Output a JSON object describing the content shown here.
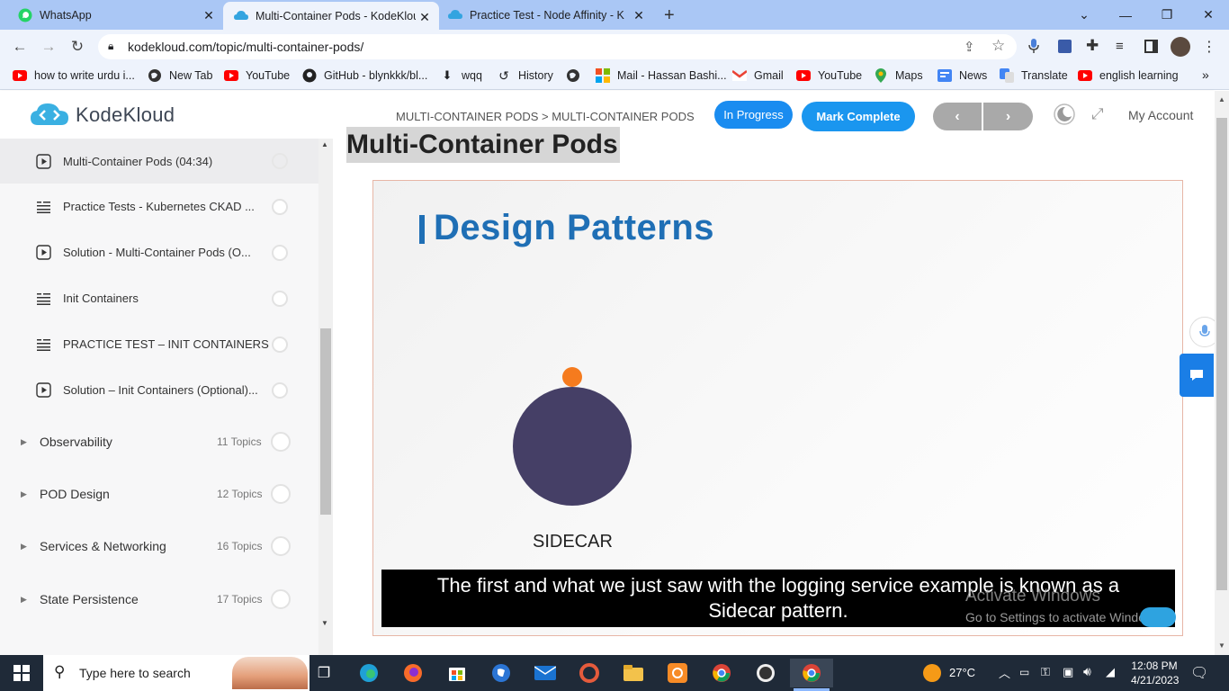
{
  "browser": {
    "tabs": [
      {
        "title": "WhatsApp",
        "active": false
      },
      {
        "title": "Multi-Container Pods - KodeKlou",
        "active": true
      },
      {
        "title": "Practice Test - Node Affinity - Ko",
        "active": false
      }
    ],
    "url": "kodekloud.com/topic/multi-container-pods/",
    "bookmarks": [
      {
        "label": "how to write urdu i...",
        "icon": "youtube-icon"
      },
      {
        "label": "New Tab",
        "icon": "globe-icon"
      },
      {
        "label": "YouTube",
        "icon": "youtube-icon"
      },
      {
        "label": "GitHub - blynkkk/bl...",
        "icon": "github-icon"
      },
      {
        "label": "wqq",
        "icon": "download-icon"
      },
      {
        "label": "History",
        "icon": "history-icon"
      },
      {
        "label": "",
        "icon": "globe-icon"
      },
      {
        "label": "Mail - Hassan Bashi...",
        "icon": "microsoft-icon"
      },
      {
        "label": "Gmail",
        "icon": "gmail-icon"
      },
      {
        "label": "YouTube",
        "icon": "youtube-icon"
      },
      {
        "label": "Maps",
        "icon": "maps-icon"
      },
      {
        "label": "News",
        "icon": "news-icon"
      },
      {
        "label": "Translate",
        "icon": "translate-icon"
      },
      {
        "label": "english learning",
        "icon": "youtube-icon"
      }
    ]
  },
  "site": {
    "logo": "KodeKloud",
    "breadcrumb": "MULTI-CONTAINER PODS > MULTI-CONTAINER PODS",
    "status_label": "In Progress",
    "mark_complete_label": "Mark Complete",
    "account_label": "My Account",
    "accent_color": "#1a8cf0"
  },
  "sidebar": {
    "lessons": [
      {
        "label": "Multi-Container Pods (04:34)",
        "icon": "video-icon",
        "current": true
      },
      {
        "label": "Practice Tests - Kubernetes CKAD ...",
        "icon": "text-icon",
        "current": false
      },
      {
        "label": "Solution - Multi-Container Pods (O...",
        "icon": "video-icon",
        "current": false
      },
      {
        "label": "Init Containers",
        "icon": "text-icon",
        "current": false
      },
      {
        "label": "PRACTICE TEST – INIT CONTAINERS",
        "icon": "text-icon",
        "current": false
      },
      {
        "label": "Solution – Init Containers (Optional)...",
        "icon": "video-icon",
        "current": false
      }
    ],
    "topics": [
      {
        "label": "Observability",
        "count": "11 Topics"
      },
      {
        "label": "POD Design",
        "count": "12 Topics"
      },
      {
        "label": "Services & Networking",
        "count": "16 Topics"
      },
      {
        "label": "State Persistence",
        "count": "17 Topics"
      }
    ]
  },
  "main": {
    "page_title": "Multi-Container Pods",
    "slide_title": "Design Patterns",
    "diagram_label": "SIDECAR",
    "caption_line1": "The first and what we just saw with the logging service example is known as a",
    "caption_line2": "Sidecar pattern.",
    "watermark_title": "Activate Windows",
    "watermark_sub": "Go to Settings to activate Windows."
  },
  "taskbar": {
    "search_placeholder": "Type here to search",
    "weather": "27°C",
    "time": "12:08 PM",
    "date": "4/21/2023"
  }
}
